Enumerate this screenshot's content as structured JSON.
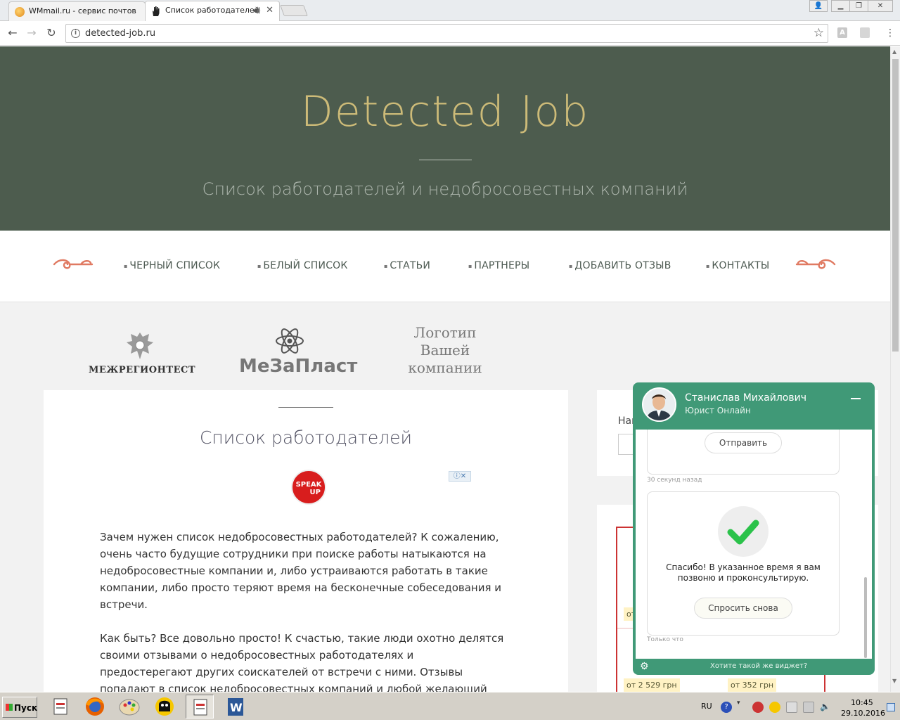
{
  "browser": {
    "tabs": [
      {
        "title": "WMmail.ru - сервис почтов",
        "active": false
      },
      {
        "title": "Список работодателей",
        "active": true
      }
    ],
    "url": "detected-job.ru",
    "icons": [
      "back-icon",
      "forward-icon",
      "reload-icon",
      "info-icon",
      "star-icon",
      "user-icon",
      "minimize-icon",
      "restore-icon",
      "close-icon",
      "audio-icon"
    ]
  },
  "hero": {
    "title": "Detected Job",
    "tagline": "Список работодателей и недобросовестных компаний"
  },
  "nav": {
    "items": [
      "ЧЕРНЫЙ СПИСОК",
      "БЕЛЫЙ СПИСОК",
      "СТАТЬИ",
      "ПАРТНЕРЫ",
      "ДОБАВИТЬ ОТЗЫВ",
      "КОНТАКТЫ"
    ]
  },
  "partners": {
    "logo1": "МЕЖРЕГИОНТЕСТ",
    "logo2": "МеЗаПласт",
    "logo3_lines": [
      "Логотип",
      "Вашей",
      "компании"
    ]
  },
  "content": {
    "title": "Список работодателей",
    "ad_badge": [
      "SPEAK",
      "UP"
    ],
    "ad_controls": "ⓘ✕",
    "paragraph1": "Зачем нужен список недобросовестных работодателей? К сожалению, очень часто будущие сотрудники при поиске работы натыкаются на недобросовестные компании и, либо устраиваются работать в такие компании, либо просто теряют время на бесконечные собеседования и встречи.",
    "paragraph2": "Как быть? Все довольно просто! К счастью, такие люди охотно делятся своими отзывами о недобросовестных работодателях и предостерегают других соискателей от встречи с ними. Отзывы попадают в список недобросовестных компаний и любой желающий может ознакомиться с"
  },
  "sidebar": {
    "search_label_partial": "Най",
    "prices": [
      "от",
      "от 2 529 грн",
      "от 352 грн"
    ]
  },
  "chat": {
    "agent_name": "Станислав Михайлович",
    "agent_role": "Юрист Онлайн",
    "send_button": "Отправить",
    "timestamp1": "30 секунд назад",
    "thanks_text_line1": "Спасибо! В указанное время я вам",
    "thanks_text_line2": "позвоню и проконсультирую.",
    "ask_again_button": "Спросить снова",
    "timestamp2": "Только что",
    "footer_link": "Хотите такой же виджет?"
  },
  "taskbar": {
    "start_label": "Пуск",
    "language": "RU",
    "time": "10:45",
    "date": "29.10.2016"
  },
  "colors": {
    "hero_bg": "#4d5c4e",
    "title_gold": "#cdbb78",
    "ornament": "#e07a62",
    "chat_green": "#409977",
    "check_green": "#2bc24a"
  }
}
